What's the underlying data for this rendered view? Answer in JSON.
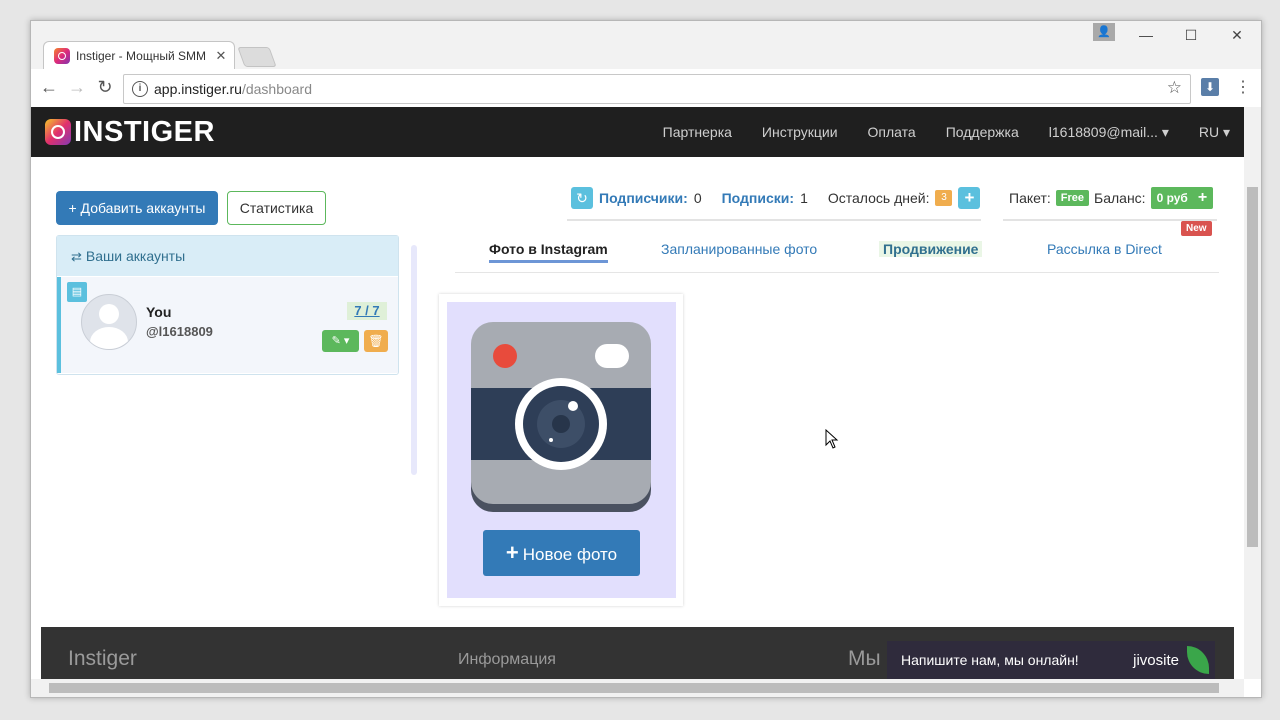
{
  "browser": {
    "tab_title": "Instiger - Мощный SMM",
    "tab_close": "✕",
    "url_host": "app.instiger.ru",
    "url_path": "/dashboard",
    "min": "—",
    "max": "☐",
    "close": "✕",
    "back": "←",
    "forward": "→",
    "reload": "↻",
    "info": "i",
    "star": "☆",
    "ext": "⬇",
    "menu": "⋮"
  },
  "navbar": {
    "logo_text": "INSTIGER",
    "links": [
      "Партнерка",
      "Инструкции",
      "Оплата",
      "Поддержка",
      "l1618809@mail... ▾",
      "RU ▾"
    ]
  },
  "actions": {
    "add_accounts": "+ Добавить аккаунты",
    "statistics": "Статистика"
  },
  "accounts": {
    "header": "Ваши аккаунты",
    "header_icon": "⇄",
    "item": {
      "name": "You",
      "username": "@l1618809",
      "count": "7 / 7",
      "edit": "✎ ▾",
      "delete": "🗑",
      "flag": "▤"
    }
  },
  "stats": {
    "refresh": "↻",
    "followers_label": "Подписчики:",
    "followers_value": "0",
    "following_label": "Подписки:",
    "following_value": "1",
    "days_label": "Осталось дней:",
    "days_value": "3",
    "add": "+"
  },
  "package": {
    "package_label": "Пакет:",
    "package_value": "Free",
    "balance_label": "Баланс:",
    "balance_value": "0 руб",
    "add": "+"
  },
  "tabs": [
    {
      "label": "Фото в Instagram"
    },
    {
      "label": "Запланированные фото"
    },
    {
      "label": "Продвижение"
    },
    {
      "label": "Рассылка в Direct"
    }
  ],
  "new_badge": "New",
  "new_photo": {
    "plus": "+",
    "label": "Новое фото"
  },
  "footer": {
    "col1": "Instiger",
    "col2": "Информация",
    "col3": "Мы"
  },
  "jivo": {
    "message": "Напишите нам, мы онлайн!",
    "brand": "jivosite"
  },
  "colors": {
    "primary": "#337ab7",
    "success": "#5cb85c",
    "info": "#5bc0de",
    "warning": "#f0ad4e",
    "danger": "#d9534f",
    "navbar": "#1f1f1f"
  }
}
